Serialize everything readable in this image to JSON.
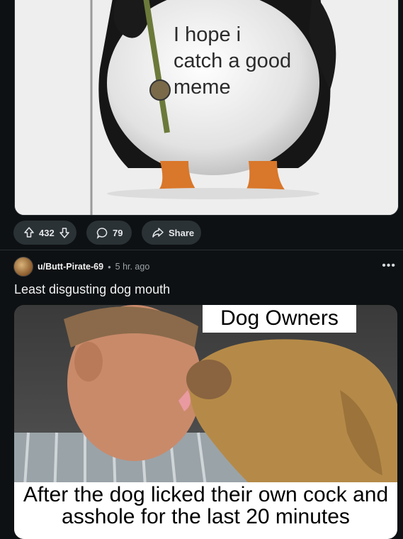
{
  "post1": {
    "image_caption": "I hope i catch a good meme",
    "upvote_count": "432",
    "comment_count": "79",
    "share_label": "Share"
  },
  "post2": {
    "author": "u/Butt-Pirate-69",
    "separator": "•",
    "time_ago": "5 hr. ago",
    "title": "Least disgusting dog mouth",
    "image_top_text": "Dog Owners",
    "image_bottom_text": "After the dog licked their own cock and asshole for the last 20 minutes"
  },
  "icons": {
    "upvote": "arrow-up-icon",
    "downvote": "arrow-down-icon",
    "comments": "comment-bubble-icon",
    "share": "share-arrow-icon",
    "more": "more-dots-icon"
  }
}
